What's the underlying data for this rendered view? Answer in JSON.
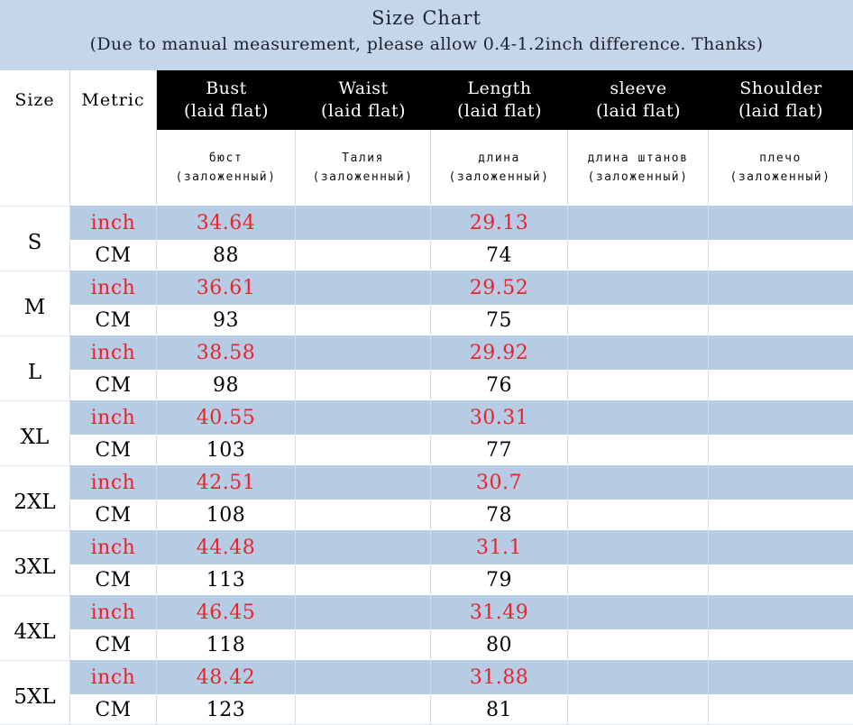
{
  "banner": {
    "title": "Size Chart",
    "note": "(Due to manual measurement, please allow 0.4-1.2inch difference. Thanks)",
    "bg_color": "#c6d6ea"
  },
  "colors": {
    "header_band": "#000000",
    "header_text": "#ffffff",
    "stripe_blue": "#b6cbe4",
    "inch_red": "#e8252a",
    "cm_black": "#000000",
    "grid_line": "#d9dde3"
  },
  "header": {
    "size_label": "Size",
    "metric_label": "Metric",
    "columns": [
      {
        "name": "Bust",
        "sub": "(laid flat)"
      },
      {
        "name": "Waist",
        "sub": "(laid flat)"
      },
      {
        "name": "Length",
        "sub": "(laid flat)"
      },
      {
        "name": "sleeve",
        "sub": "(laid flat)"
      },
      {
        "name": "Shoulder",
        "sub": "(laid flat)"
      }
    ]
  },
  "subheader": {
    "bust": "бюст (заложенный)",
    "waist": "Талия (заложенный)",
    "length": "длина (заложенный)",
    "sleeve": "длина штанов (заложенный)",
    "shoulder": "плечо (заложенный)"
  },
  "metric_labels": {
    "inch": "inch",
    "cm": "CM"
  },
  "rows": [
    {
      "size": "S",
      "inch": {
        "bust": "34.64",
        "waist": "",
        "length": "29.13",
        "sleeve": "",
        "shoulder": ""
      },
      "cm": {
        "bust": "88",
        "waist": "",
        "length": "74",
        "sleeve": "",
        "shoulder": ""
      }
    },
    {
      "size": "M",
      "inch": {
        "bust": "36.61",
        "waist": "",
        "length": "29.52",
        "sleeve": "",
        "shoulder": ""
      },
      "cm": {
        "bust": "93",
        "waist": "",
        "length": "75",
        "sleeve": "",
        "shoulder": ""
      }
    },
    {
      "size": "L",
      "inch": {
        "bust": "38.58",
        "waist": "",
        "length": "29.92",
        "sleeve": "",
        "shoulder": ""
      },
      "cm": {
        "bust": "98",
        "waist": "",
        "length": "76",
        "sleeve": "",
        "shoulder": ""
      }
    },
    {
      "size": "XL",
      "inch": {
        "bust": "40.55",
        "waist": "",
        "length": "30.31",
        "sleeve": "",
        "shoulder": ""
      },
      "cm": {
        "bust": "103",
        "waist": "",
        "length": "77",
        "sleeve": "",
        "shoulder": ""
      }
    },
    {
      "size": "2XL",
      "inch": {
        "bust": "42.51",
        "waist": "",
        "length": "30.7",
        "sleeve": "",
        "shoulder": ""
      },
      "cm": {
        "bust": "108",
        "waist": "",
        "length": "78",
        "sleeve": "",
        "shoulder": ""
      }
    },
    {
      "size": "3XL",
      "inch": {
        "bust": "44.48",
        "waist": "",
        "length": "31.1",
        "sleeve": "",
        "shoulder": ""
      },
      "cm": {
        "bust": "113",
        "waist": "",
        "length": "79",
        "sleeve": "",
        "shoulder": ""
      }
    },
    {
      "size": "4XL",
      "inch": {
        "bust": "46.45",
        "waist": "",
        "length": "31.49",
        "sleeve": "",
        "shoulder": ""
      },
      "cm": {
        "bust": "118",
        "waist": "",
        "length": "80",
        "sleeve": "",
        "shoulder": ""
      }
    },
    {
      "size": "5XL",
      "inch": {
        "bust": "48.42",
        "waist": "",
        "length": "31.88",
        "sleeve": "",
        "shoulder": ""
      },
      "cm": {
        "bust": "123",
        "waist": "",
        "length": "81",
        "sleeve": "",
        "shoulder": ""
      }
    }
  ]
}
